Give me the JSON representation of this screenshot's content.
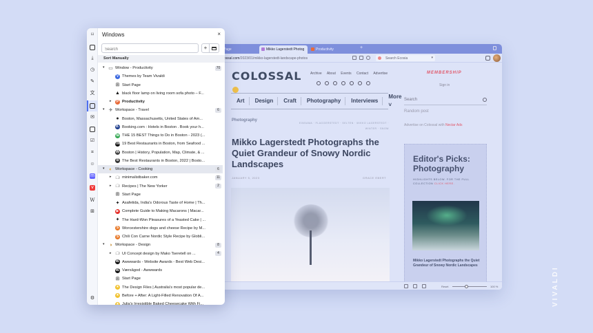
{
  "watermark": "VIVALDI",
  "browser": {
    "tabs": [
      {
        "label": "Page",
        "favicon": "#8fa0e6"
      },
      {
        "label": "Mikko Lagerstedt Photog",
        "favicon": "#b07cd8",
        "active": true
      },
      {
        "label": "Productivity",
        "favicon": "#e86b3a"
      }
    ],
    "url_host": "olossal.com",
    "url_path": "/2023/01/mikko-lagerstedt-landscape-photos",
    "search_placeholder": "Search Ecosia",
    "status_reset": "Reset",
    "status_zoom": "100 %"
  },
  "site": {
    "logo": "COLOSSAL",
    "topnav": [
      "Archive",
      "About",
      "Events",
      "Contact",
      "Advertise"
    ],
    "membership": "MEMBERSHIP",
    "signin": "Sign in",
    "nav": [
      "Art",
      "Design",
      "Craft",
      "Photography",
      "Interviews",
      "More ˅"
    ],
    "search": "Search",
    "random_post": "Random post",
    "advertise_text": "Advertise on Colossal with",
    "advertise_link": "Nectar Ads",
    "category": "Photography",
    "tags": "EINSAMA   · FLAGGERSTEDT · SELTEN · MIKKO LAGERSTEDT · WINTER · SNOW",
    "headline": "Mikko Lagerstedt Photographs the Quiet Grandeur of Snowy Nordic Landscapes",
    "date": "JANUARY 5, 2023",
    "author": "GRACE EBERT",
    "editors_title": "Editor's Picks: Photography",
    "editors_sub": "HIGHLIGHTS BELOW. FOR THE FULL COLLECTION",
    "editors_link": "CLICK HERE.",
    "editors_caption": "Mikko Lagerstedt Photographs the Quiet Grandeur of Snowy Nordic Landscapes"
  },
  "panel": {
    "title": "Windows",
    "close": "×",
    "search_placeholder": "Search",
    "add": "+",
    "sort_label": "Sort Manually",
    "rows": [
      {
        "level": 0,
        "arrow": "▾",
        "icon": "window",
        "color": "#666",
        "text": "Window - Productivity",
        "badge": "70"
      },
      {
        "level": 1,
        "icon": "V",
        "color": "#3a68e0",
        "text": "Themes by Team Vivaldi"
      },
      {
        "level": 1,
        "icon": "grid",
        "color": "#555",
        "text": "Start Page"
      },
      {
        "level": 1,
        "icon": "lamp",
        "color": "#111",
        "text": "black floor lamp on living room sofa photo – F..."
      },
      {
        "level": 1,
        "arrow": "▸",
        "icon": "P",
        "color": "#e86b3a",
        "text": "Productivity",
        "bold": true
      },
      {
        "level": 0,
        "arrow": "▾",
        "icon": "plane",
        "color": "#555",
        "text": "Workspace - Travel",
        "badge": "6"
      },
      {
        "level": 1,
        "icon": "globe",
        "color": "#222",
        "text": "Boston, Massachusetts, United States of Am..."
      },
      {
        "level": 1,
        "icon": "B.",
        "color": "#1a3a8a",
        "text": "Booking.com : Hotels in Boston . Book your h..."
      },
      {
        "level": 1,
        "icon": "ta",
        "color": "#34a853",
        "text": "THE 15 BEST Things to Do in Boston - 2023 (..."
      },
      {
        "level": 1,
        "icon": "TM",
        "color": "#111",
        "text": "19 Best Restaurants in Boston, from Seafood ..."
      },
      {
        "level": 1,
        "icon": "W",
        "color": "#444",
        "text": "Boston | History, Population, Map, Climate, & ..."
      },
      {
        "level": 1,
        "icon": "B",
        "color": "#333",
        "text": "The Best Restaurants in Boston, 2022 | Bosto..."
      },
      {
        "level": 0,
        "arrow": "▾",
        "icon": "food",
        "color": "#e0a020",
        "text": "Workspace - Cooking",
        "badge": "6",
        "selected": true
      },
      {
        "level": 1,
        "arrow": "▸",
        "icon": "stack",
        "color": "#666",
        "text": "minimalistbaker.com",
        "badge": "11"
      },
      {
        "level": 1,
        "arrow": "▸",
        "icon": "stack",
        "color": "#666",
        "text": "Recipes | The New Yorker",
        "badge": "2"
      },
      {
        "level": 1,
        "icon": "grid",
        "color": "#555",
        "text": "Start Page"
      },
      {
        "level": 1,
        "icon": "pin",
        "color": "#111",
        "text": "Asafetida, India's Odorous Taste of Home | Th..."
      },
      {
        "level": 1,
        "icon": "▶",
        "color": "#e52d27",
        "text": "Complete Guide to Making Macarons | Macar..."
      },
      {
        "level": 1,
        "icon": "pin",
        "color": "#111",
        "text": "The Hard-Won Pleasures of a Yeasted Cake | ..."
      },
      {
        "level": 1,
        "icon": "S",
        "color": "#e87a2a",
        "text": "Worcestershire dogs and cheese Recipe by M..."
      },
      {
        "level": 1,
        "icon": "S",
        "color": "#e87a2a",
        "text": "Chili Con Carne Nordic Style Recipe by Globli..."
      },
      {
        "level": 0,
        "arrow": "▾",
        "icon": "palette",
        "color": "#c58a30",
        "text": "Workspace - Design",
        "badge": "8"
      },
      {
        "level": 1,
        "arrow": "▸",
        "icon": "stack",
        "color": "#666",
        "text": "UI Concept design by Mako Tseretell on ...",
        "badge": "4"
      },
      {
        "level": 1,
        "icon": "W.",
        "color": "#111",
        "text": "Awwwards - Website Awards - Best Web Desi..."
      },
      {
        "level": 1,
        "icon": "W.",
        "color": "#111",
        "text": "Værsågod - Awwwards"
      },
      {
        "level": 1,
        "icon": "grid",
        "color": "#555",
        "text": "Start Page"
      },
      {
        "level": 1,
        "icon": "★",
        "color": "#f2c230",
        "text": "The Design Files | Australia's most popular de..."
      },
      {
        "level": 1,
        "icon": "★",
        "color": "#f2c230",
        "text": "Before + After: A Light-Filled Renovation Of A..."
      },
      {
        "level": 1,
        "icon": "★",
        "color": "#f2c230",
        "text": "Julia's Irresistible Baked Cheesecake With Fi..."
      }
    ]
  }
}
